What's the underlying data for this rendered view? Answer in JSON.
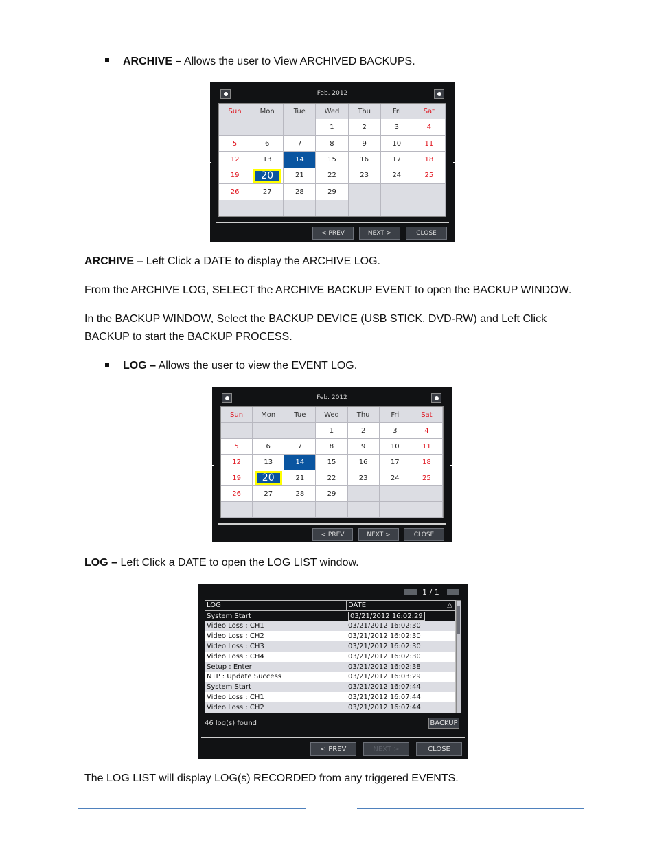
{
  "doc": {
    "bullet_archive": {
      "term": "ARCHIVE –",
      "text": " Allows the user to View ARCHIVED BACKUPS."
    },
    "para_archive_click": {
      "term": "ARCHIVE",
      "text": " – Left Click a DATE to display the ARCHIVE LOG."
    },
    "para_archive_log": "From the ARCHIVE LOG, SELECT the ARCHIVE BACKUP EVENT to open the BACKUP WINDOW.",
    "para_backup_window": "In the BACKUP WINDOW, Select the BACKUP DEVICE (USB STICK, DVD-RW) and Left Click BACKUP to start the BACKUP PROCESS.",
    "bullet_log": {
      "term": "LOG –",
      "text": " Allows the user to view the EVENT LOG."
    },
    "para_log_click": {
      "term": "LOG –",
      "text": " Left Click a DATE to open the LOG LIST window."
    },
    "para_log_list": "The LOG LIST will display LOG(s) RECORDED from any triggered EVENTS."
  },
  "calendar_archive": {
    "title": "Feb, 2012",
    "prev_icon": "circle-left-icon",
    "next_icon": "circle-right-icon",
    "weekdays": [
      "Sun",
      "Mon",
      "Tue",
      "Wed",
      "Thu",
      "Fri",
      "Sat"
    ],
    "weeks": [
      [
        "",
        "",
        "",
        "1",
        "2",
        "3",
        "4"
      ],
      [
        "5",
        "6",
        "7",
        "8",
        "9",
        "10",
        "11"
      ],
      [
        "12",
        "13",
        "14",
        "15",
        "16",
        "17",
        "18"
      ],
      [
        "19",
        "20",
        "21",
        "22",
        "23",
        "24",
        "25"
      ],
      [
        "26",
        "27",
        "28",
        "29",
        "",
        "",
        ""
      ],
      [
        "",
        "",
        "",
        "",
        "",
        "",
        ""
      ]
    ],
    "highlighted_date": "14",
    "today_date": "20",
    "buttons": {
      "prev": "< PREV",
      "next": "NEXT >",
      "close": "CLOSE"
    }
  },
  "calendar_log": {
    "title": "Feb. 2012",
    "prev_icon": "circle-left-icon",
    "next_icon": "circle-right-icon",
    "weekdays": [
      "Sun",
      "Mon",
      "Tue",
      "Wed",
      "Thu",
      "Fri",
      "Sat"
    ],
    "weeks": [
      [
        "",
        "",
        "",
        "1",
        "2",
        "3",
        "4"
      ],
      [
        "5",
        "6",
        "7",
        "8",
        "9",
        "10",
        "11"
      ],
      [
        "12",
        "13",
        "14",
        "15",
        "16",
        "17",
        "18"
      ],
      [
        "19",
        "20",
        "21",
        "22",
        "23",
        "24",
        "25"
      ],
      [
        "26",
        "27",
        "28",
        "29",
        "",
        "",
        ""
      ],
      [
        "",
        "",
        "",
        "",
        "",
        "",
        ""
      ]
    ],
    "highlighted_date": "14",
    "today_date": "20",
    "buttons": {
      "prev": "< PREV",
      "next": "NEXT >",
      "close": "CLOSE"
    }
  },
  "log_list": {
    "page": "1 / 1",
    "columns": {
      "log": "LOG",
      "date": "DATE",
      "sort_icon": "△"
    },
    "rows": [
      {
        "log": "System Start",
        "date": "03/21/2012 16:02:29"
      },
      {
        "log": "Video Loss : CH1",
        "date": "03/21/2012 16:02:30"
      },
      {
        "log": "Video Loss : CH2",
        "date": "03/21/2012 16:02:30"
      },
      {
        "log": "Video Loss : CH3",
        "date": "03/21/2012 16:02:30"
      },
      {
        "log": "Video Loss : CH4",
        "date": "03/21/2012 16:02:30"
      },
      {
        "log": "Setup : Enter",
        "date": "03/21/2012 16:02:38"
      },
      {
        "log": "NTP : Update Success",
        "date": "03/21/2012 16:03:29"
      },
      {
        "log": "System Start",
        "date": "03/21/2012 16:07:44"
      },
      {
        "log": "Video Loss : CH1",
        "date": "03/21/2012 16:07:44"
      },
      {
        "log": "Video Loss : CH2",
        "date": "03/21/2012 16:07:44"
      }
    ],
    "found_text": "46 log(s) found",
    "backup_label": "BACKUP",
    "buttons": {
      "prev": "< PREV",
      "next": "NEXT >",
      "close": "CLOSE"
    }
  }
}
